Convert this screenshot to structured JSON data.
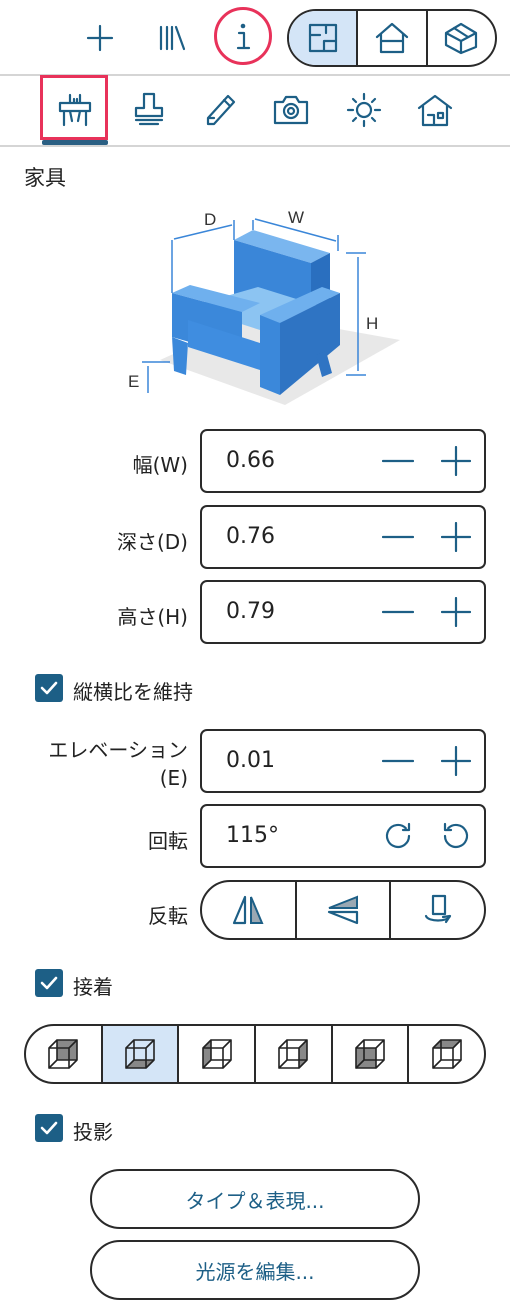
{
  "toolbar": {
    "icons": [
      "plus-icon",
      "library-icon",
      "info-icon"
    ],
    "view_modes": [
      "plan-view-icon",
      "house-front-icon",
      "house-3d-icon"
    ],
    "selected_view": 0
  },
  "tabs": [
    "furniture-dimensions-icon",
    "stamp-icon",
    "pencil-icon",
    "camera-icon",
    "sun-icon",
    "house-icon"
  ],
  "selected_tab": 0,
  "section": {
    "title": "家具",
    "diagram_labels": {
      "d": "D",
      "w": "W",
      "h": "H",
      "e": "E"
    }
  },
  "fields": {
    "width": {
      "label": "幅(W)",
      "value": "0.66"
    },
    "depth": {
      "label": "深さ(D)",
      "value": "0.76"
    },
    "height": {
      "label": "高さ(H)",
      "value": "0.79"
    },
    "elevation": {
      "label_line1": "エレベーション",
      "label_line2": "(E)",
      "value": "0.01"
    },
    "rotation": {
      "label": "回転",
      "value": "115°"
    }
  },
  "keep_ratio": {
    "label": "縦横比を維持",
    "checked": true
  },
  "flip": {
    "label": "反転",
    "options": [
      "flip-horizontal-icon",
      "flip-vertical-icon",
      "flip-rotate-icon"
    ]
  },
  "glue": {
    "label": "接着",
    "checked": true,
    "options": [
      "cube-back-face-icon",
      "cube-bottom-face-icon",
      "cube-left-face-icon",
      "cube-right-face-icon",
      "cube-front-face-icon",
      "cube-top-face-icon"
    ],
    "selected": 1
  },
  "shadow": {
    "label": "投影",
    "checked": true
  },
  "buttons": {
    "type_appearance": "タイプ＆表現...",
    "edit_light": "光源を編集..."
  },
  "colors": {
    "accent": "#1d5f86",
    "highlight": "#e8325a",
    "selected_fill": "#d4e5f7",
    "chair_blue": "#3a86d8"
  }
}
